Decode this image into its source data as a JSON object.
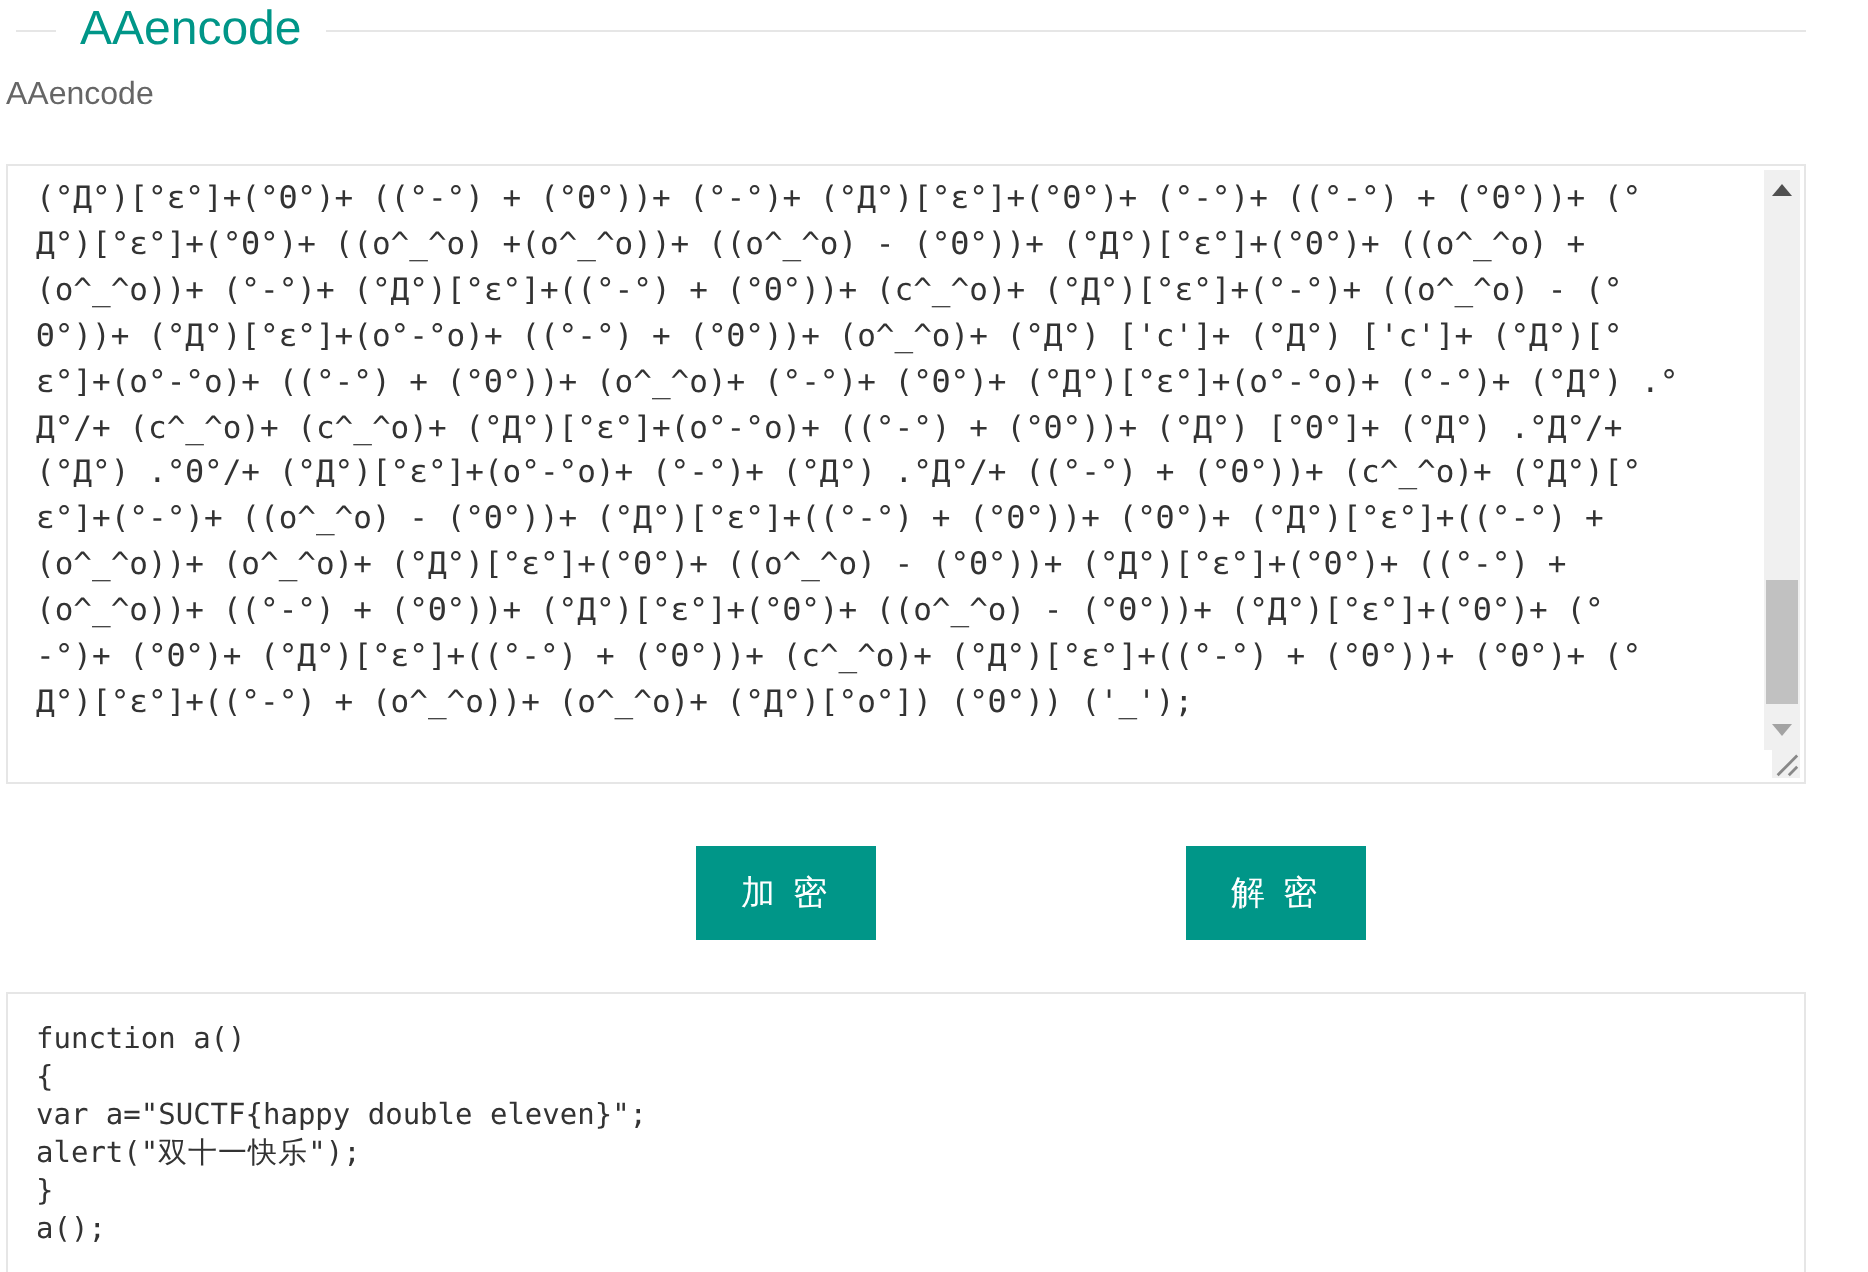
{
  "header": {
    "title": "AAencode",
    "subtitle": "AAencode"
  },
  "input_area": {
    "lines": [
      "(°Д°)[°ε°]+(°Θ°)+ ((°-°) + (°Θ°))+ (°-°)+ (°Д°)[°ε°]+(°Θ°)+ (°-°)+ ((°-°) + (°Θ°))+ (°",
      "Д°)[°ε°]+(°Θ°)+ ((o^_^o) +(o^_^o))+ ((o^_^o) - (°Θ°))+ (°Д°)[°ε°]+(°Θ°)+ ((o^_^o) +",
      "(o^_^o))+ (°-°)+ (°Д°)[°ε°]+((°-°) + (°Θ°))+ (c^_^o)+ (°Д°)[°ε°]+(°-°)+ ((o^_^o) - (°",
      "Θ°))+ (°Д°)[°ε°]+(o°-°o)+ ((°-°) + (°Θ°))+ (o^_^o)+ (°Д°) ['c']+ (°Д°) ['c']+ (°Д°)[°",
      "ε°]+(o°-°o)+ ((°-°) + (°Θ°))+ (o^_^o)+ (°-°)+ (°Θ°)+ (°Д°)[°ε°]+(o°-°o)+ (°-°)+ (°Д°) .°",
      "Д°/+ (c^_^o)+ (c^_^o)+ (°Д°)[°ε°]+(o°-°o)+ ((°-°) + (°Θ°))+ (°Д°) [°Θ°]+ (°Д°) .°Д°/+",
      "(°Д°) .°Θ°/+ (°Д°)[°ε°]+(o°-°o)+ (°-°)+ (°Д°) .°Д°/+ ((°-°) + (°Θ°))+ (c^_^o)+ (°Д°)[°",
      "ε°]+(°-°)+ ((o^_^o) - (°Θ°))+ (°Д°)[°ε°]+((°-°) + (°Θ°))+ (°Θ°)+ (°Д°)[°ε°]+((°-°) +",
      "(o^_^o))+ (o^_^o)+ (°Д°)[°ε°]+(°Θ°)+ ((o^_^o) - (°Θ°))+ (°Д°)[°ε°]+(°Θ°)+ ((°-°) +",
      "(o^_^o))+ ((°-°) + (°Θ°))+ (°Д°)[°ε°]+(°Θ°)+ ((o^_^o) - (°Θ°))+ (°Д°)[°ε°]+(°Θ°)+ (°",
      "-°)+ (°Θ°)+ (°Д°)[°ε°]+((°-°) + (°Θ°))+ (c^_^o)+ (°Д°)[°ε°]+((°-°) + (°Θ°))+ (°Θ°)+ (°",
      "Д°)[°ε°]+((°-°) + (o^_^o))+ (o^_^o)+ (°Д°)[°o°]) (°Θ°)) ('_');"
    ]
  },
  "buttons": [
    {
      "label": "加 密"
    },
    {
      "label": "解 密"
    }
  ],
  "output_area": {
    "lines": [
      "function a()",
      "{",
      "var a=\"SUCTF{happy double eleven}\";",
      "alert(\"双十一快乐\");",
      "}",
      "a();"
    ]
  }
}
